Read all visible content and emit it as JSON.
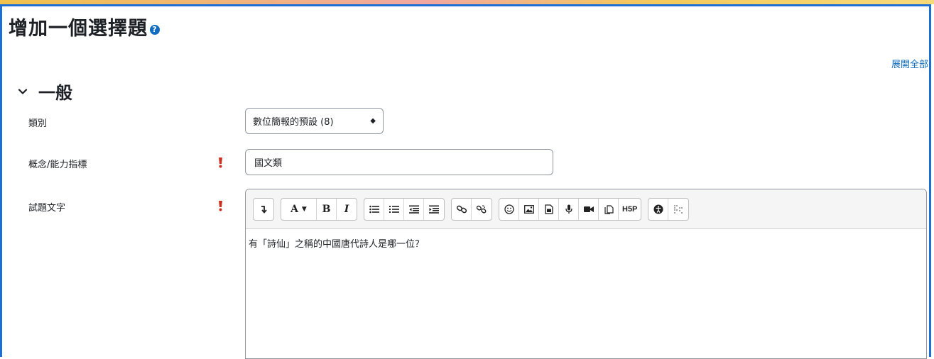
{
  "page": {
    "title": "增加一個選擇題",
    "expand_all": "展開全部",
    "colors": {
      "accent": "#0f6cbf",
      "frame": "#1e6fd3",
      "required": "#ca3120"
    }
  },
  "section": {
    "title": "一般"
  },
  "fields": {
    "category": {
      "label": "類別",
      "value": "數位簡報的預設 (8)"
    },
    "concept": {
      "label": "概念/能力指標",
      "value": "國文類"
    },
    "question_text": {
      "label": "試題文字",
      "content": "有「詩仙」之稱的中國唐代詩人是哪一位？"
    }
  },
  "toolbar": {
    "bold": "B",
    "italic": "I",
    "font_color": "A",
    "h5p": "H5P",
    "icons": [
      "collapse-icon",
      "font-color-icon",
      "bold-icon",
      "italic-icon",
      "unordered-list-icon",
      "ordered-list-icon",
      "outdent-icon",
      "indent-icon",
      "link-icon",
      "unlink-icon",
      "emoji-icon",
      "image-icon",
      "media-icon",
      "record-audio-icon",
      "record-video-icon",
      "manage-files-icon",
      "h5p-icon",
      "accessibility-checker-icon",
      "screenreader-helper-icon"
    ]
  }
}
